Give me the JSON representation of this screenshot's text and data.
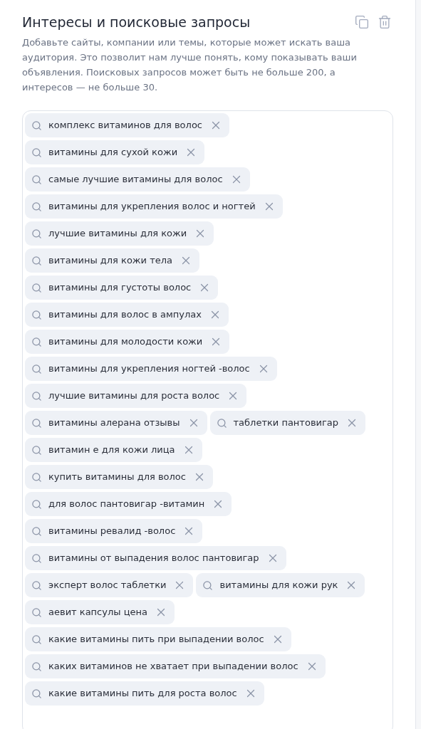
{
  "title": "Интересы и поисковые запросы",
  "description": "Добавьте сайты, компании или темы, которые может искать ваша аудитория. Это позволит нам лучше понять, кому показывать ваши объявления. Поисковых запросов может быть не больше 200, а интересов — не больше 30.",
  "queries": [
    {
      "text": "комплекс витаминов для волос"
    },
    {
      "text": "витамины для сухой кожи"
    },
    {
      "text": "самые лучшие витамины для волос"
    },
    {
      "text": "витамины для укрепления волос и ногтей"
    },
    {
      "text": "лучшие витамины для кожи"
    },
    {
      "text": "витамины для кожи тела"
    },
    {
      "text": "витамины для густоты волос"
    },
    {
      "text": "витамины для волос в ампулах"
    },
    {
      "text": "витамины для молодости кожи"
    },
    {
      "text": "витамины для укрепления ногтей -волос"
    },
    {
      "text": "лучшие витамины для роста волос"
    },
    {
      "text": "витамины алерана отзывы"
    },
    {
      "text": "таблетки пантовигар"
    },
    {
      "text": "витамин е для кожи лица"
    },
    {
      "text": "купить витамины для волос"
    },
    {
      "text": "для волос пантовигар -витамин"
    },
    {
      "text": "витамины ревалид -волос"
    },
    {
      "text": "витамины от выпадения волос пантовигар"
    },
    {
      "text": "эксперт волос таблетки"
    },
    {
      "text": "витамины для кожи рук"
    },
    {
      "text": "аевит капсулы цена"
    },
    {
      "text": "какие витамины пить при выпадении волос"
    },
    {
      "text": "каких витаминов не хватает при выпадении волос"
    },
    {
      "text": "какие витамины пить для роста волос"
    }
  ]
}
